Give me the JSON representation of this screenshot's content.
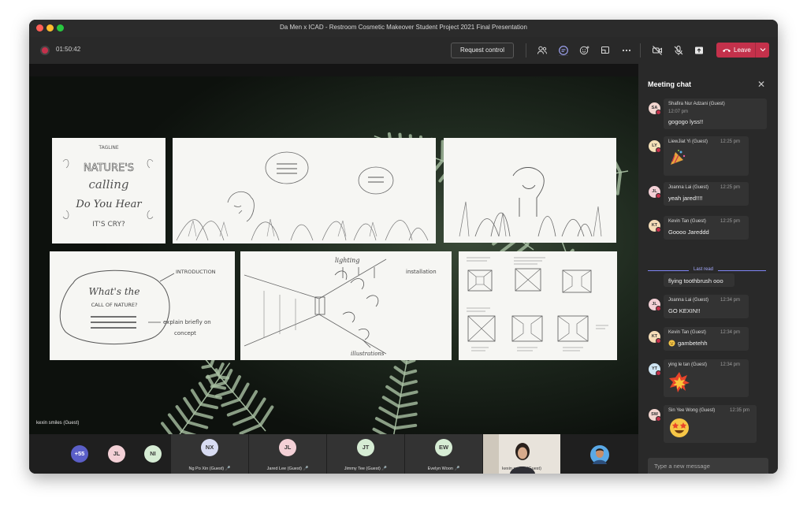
{
  "window": {
    "title": "Da Men x ICAD - Restroom Cosmetic Makeover Student Project 2021 Final Presentation"
  },
  "toolbar": {
    "timer": "01:50:42",
    "request_control": "Request control",
    "leave": "Leave",
    "icons": [
      "people-icon",
      "chat-icon",
      "reactions-icon",
      "rooms-icon",
      "more-icon",
      "camera-off-icon",
      "mic-off-icon",
      "share-icon"
    ]
  },
  "stage": {
    "speaker_name": "kexin smiles (Guest)",
    "sketches": {
      "tagline": {
        "title": "TAGLINE",
        "line1": "NATURE'S",
        "line2": "calling",
        "line3": "Do You Hear",
        "line4": "IT'S CRY?"
      },
      "concept": {
        "heading": "What's the",
        "sub": "CALL OF NATURE?",
        "label1": "INTRODUCTION",
        "label2": "explain briefly on",
        "label3": "concept"
      },
      "corridor": {
        "label1": "lighting",
        "label2": "installation",
        "label3": "illustrations"
      }
    }
  },
  "chat": {
    "title": "Meeting chat",
    "last_read": "Last read",
    "messages": [
      {
        "initials": "SA",
        "sender": "Shafira Nur Adzani (Guest)",
        "time": "12:07 pm",
        "text": "gogogo lyss!!",
        "avatar_color": "#f3d6d0"
      },
      {
        "initials": "LY",
        "sender": "LiewJiat Yi (Guest)",
        "time": "12:25 pm",
        "text": "",
        "emoji": "party-popper-icon",
        "avatar_color": "#f5e1b8"
      },
      {
        "initials": "JL",
        "sender": "Joanna Lai (Guest)",
        "time": "12:25 pm",
        "text": "yeah jared!!!!",
        "avatar_color": "#f3d0d6"
      },
      {
        "initials": "KT",
        "sender": "Kevin Tan (Guest)",
        "time": "12:25 pm",
        "text": "Goooo Jareddd",
        "avatar_color": "#f5ddb8"
      },
      {
        "initials": "",
        "sender": "",
        "time": "",
        "text": "flying toothbrush ooo",
        "avatar_color": ""
      },
      {
        "initials": "JL",
        "sender": "Joanna Lai (Guest)",
        "time": "12:34 pm",
        "text": "GO KEXIN!!",
        "avatar_color": "#f3d0d6"
      },
      {
        "initials": "KT",
        "sender": "Kevin Tan (Guest)",
        "time": "12:34 pm",
        "text": "gambetehh",
        "emoji_prefix": "grin-icon",
        "avatar_color": "#f5ddb8"
      },
      {
        "initials": "YT",
        "sender": "ying le tan (Guest)",
        "time": "12:34 pm",
        "text": "",
        "emoji": "collision-icon",
        "avatar_color": "#cfe5f3"
      },
      {
        "initials": "SW",
        "sender": "Sin Yee Wong (Guest)",
        "time": "12:35 pm",
        "text": "",
        "emoji": "star-struck-icon",
        "avatar_color": "#f3d6d0"
      }
    ],
    "compose_placeholder": "Type a new message",
    "tools": [
      "format-icon",
      "emoji-icon",
      "gif-icon",
      "sticker-icon",
      "more-icon",
      "send-icon"
    ]
  },
  "participants": {
    "overflow": "+55",
    "small": [
      {
        "initials": "JL",
        "color": "#f3d0d6"
      },
      {
        "initials": "NI",
        "color": "#d6ecd4"
      }
    ],
    "tiles": [
      {
        "initials": "NX",
        "name": "Ng Po Xin (Guest)",
        "color": "#d8dcf2"
      },
      {
        "initials": "JL",
        "name": "Jared Lee (Guest)",
        "color": "#f3d0d6"
      },
      {
        "initials": "JT",
        "name": "Jimmy Tee (Guest)",
        "color": "#d6ecd4"
      },
      {
        "initials": "EW",
        "name": "Evelyn Woon",
        "color": "#d6ecd4"
      },
      {
        "initials": "",
        "name": "kexin smiles (Guest)",
        "color": ""
      }
    ]
  },
  "colors": {
    "accent": "#7f85f5",
    "leave": "#c4314b",
    "background": "#1f1f1f",
    "panel": "#292929"
  }
}
